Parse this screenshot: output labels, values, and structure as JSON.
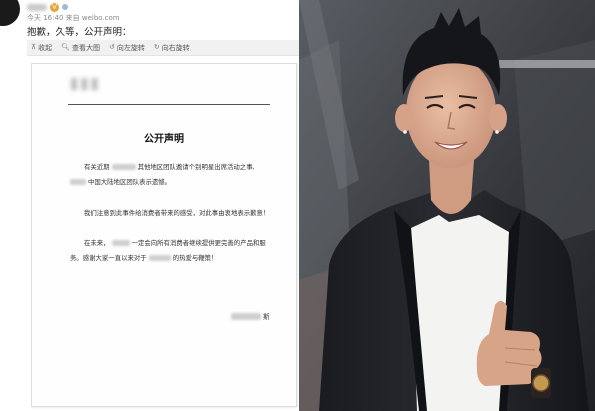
{
  "post": {
    "time": "今天 16:40 来自 weibo.com",
    "text": "抱歉，久等，公开声明：",
    "toolbar": [
      {
        "icon": "收",
        "label": "收起"
      },
      {
        "icon": "🔍",
        "label": "查看大图"
      },
      {
        "icon": "↺",
        "label": "向左旋转"
      },
      {
        "icon": "↻",
        "label": "向右旋转"
      }
    ]
  },
  "doc": {
    "title": "公开声明",
    "p1a": "有关近期",
    "p1b": "其他地区团队邀请个别明星出席活动之事,",
    "p1c": "中国大陆地区团队表示遗憾。",
    "p2": "我们注意到此事件给消费者带来的感受，对此事由衷地表示歉意！",
    "p3a": "在未来，",
    "p3b": "一定会向所有消费者继续提供更完善的产品和服",
    "p3c": "务。感谢大家一直以来对于",
    "p3d": "的热爱与鞭策！",
    "sig_suffix": "斯"
  },
  "colors": {
    "toolbar_bg": "#f1f1f1",
    "badge": "#e9a33b",
    "photo_bg": "#3a3d42"
  }
}
